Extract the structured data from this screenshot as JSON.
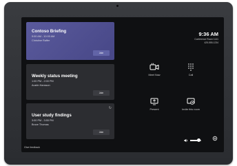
{
  "meetings": [
    {
      "title": "Contoso Briefing",
      "time": "9:00 AM - 10:00 AM",
      "organizer": "Christine Raffer",
      "button": "Join"
    },
    {
      "title": "Weekly status meeting",
      "time": "1:00 PM - 2:00 PM",
      "organizer": "Austin Hansson",
      "button": "Join"
    },
    {
      "title": "User study findings",
      "time": "3:00 PM - 3:55 PM",
      "organizer": "Bruce Thomas",
      "button": "Join"
    }
  ],
  "clock": {
    "time": "9:36 AM",
    "room": "Conference Room 1141",
    "phone": "425-555-1234"
  },
  "actions": {
    "meet_now": "Meet Now",
    "call": "Call",
    "present": "Present",
    "invite": "Invite this room"
  },
  "volume": {
    "level": 0.75
  },
  "footer": {
    "feedback": "Give feedback"
  },
  "colors": {
    "accent": "#6264a7",
    "screen_bg": "#0f1012",
    "card_bg": "#2c2d31",
    "bezel": "#2f3135"
  },
  "icons": [
    "video-camera-icon",
    "dialpad-icon",
    "present-icon",
    "invite-room-icon",
    "volume-icon",
    "settings-icon",
    "recurring-icon"
  ]
}
